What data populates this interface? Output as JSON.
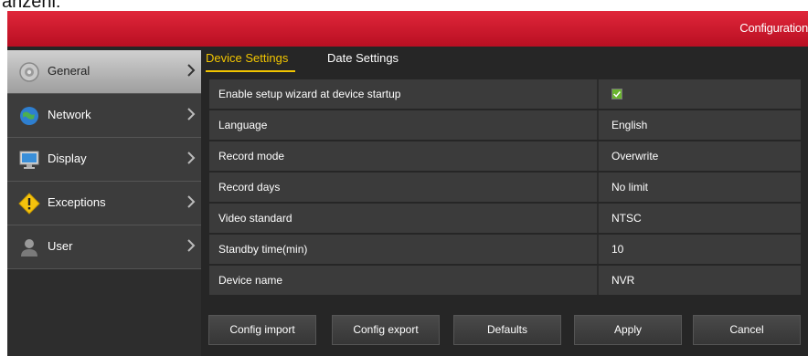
{
  "page_caption": "anzehi:",
  "header": {
    "title": "Configuration"
  },
  "sidebar": {
    "items": [
      {
        "label": "General",
        "active": true,
        "icon": "gear-icon"
      },
      {
        "label": "Network",
        "active": false,
        "icon": "globe-icon"
      },
      {
        "label": "Display",
        "active": false,
        "icon": "monitor-icon"
      },
      {
        "label": "Exceptions",
        "active": false,
        "icon": "warning-icon"
      },
      {
        "label": "User",
        "active": false,
        "icon": "user-icon"
      }
    ]
  },
  "tabs": [
    {
      "label": "Device Settings",
      "active": true
    },
    {
      "label": "Date Settings",
      "active": false
    }
  ],
  "settings": {
    "rows": [
      {
        "label": "Enable setup wizard at device startup",
        "type": "checkbox",
        "checked": true
      },
      {
        "label": "Language",
        "value": "English"
      },
      {
        "label": "Record mode",
        "value": "Overwrite"
      },
      {
        "label": "Record days",
        "value": "No limit"
      },
      {
        "label": "Video standard",
        "value": "NTSC"
      },
      {
        "label": "Standby time(min)",
        "value": "10"
      },
      {
        "label": "Device name",
        "value": "NVR"
      }
    ]
  },
  "buttons": {
    "config_import": "Config import",
    "config_export": "Config export",
    "defaults": "Defaults",
    "apply": "Apply",
    "cancel": "Cancel"
  },
  "colors": {
    "header_red": "#c8102e",
    "active_tab": "#f2c500",
    "checkbox_green": "#6ab52e"
  }
}
